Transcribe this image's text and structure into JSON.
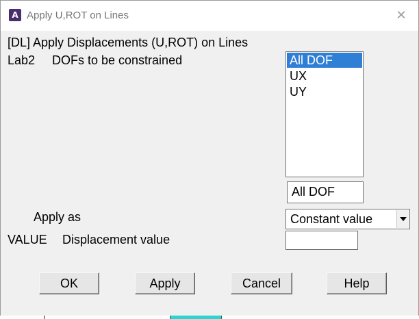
{
  "window": {
    "title": "Apply U,ROT on Lines",
    "app_icon_letter": "A",
    "close_glyph": "✕"
  },
  "header": {
    "command_label": "[DL]  Apply Displacements (U,ROT) on Lines"
  },
  "lab2": {
    "code": "Lab2",
    "label": "DOFs to be constrained",
    "options": [
      {
        "label": "All DOF",
        "selected": true
      },
      {
        "label": "UX",
        "selected": false
      },
      {
        "label": "UY",
        "selected": false
      }
    ],
    "selection_value": "All DOF"
  },
  "apply_as": {
    "label": "Apply as",
    "selected": "Constant value"
  },
  "value": {
    "code": "VALUE",
    "label": "Displacement value",
    "input_value": ""
  },
  "buttons": {
    "ok": "OK",
    "apply": "Apply",
    "cancel": "Cancel",
    "help": "Help"
  },
  "colors": {
    "selection": "#2f7fd6",
    "dialog_bg": "#f0f0f0",
    "app_icon": "#4a2d6f"
  },
  "icons": {
    "app": "ansys-app-icon",
    "close": "close-icon",
    "dropdown": "chevron-down-icon"
  }
}
